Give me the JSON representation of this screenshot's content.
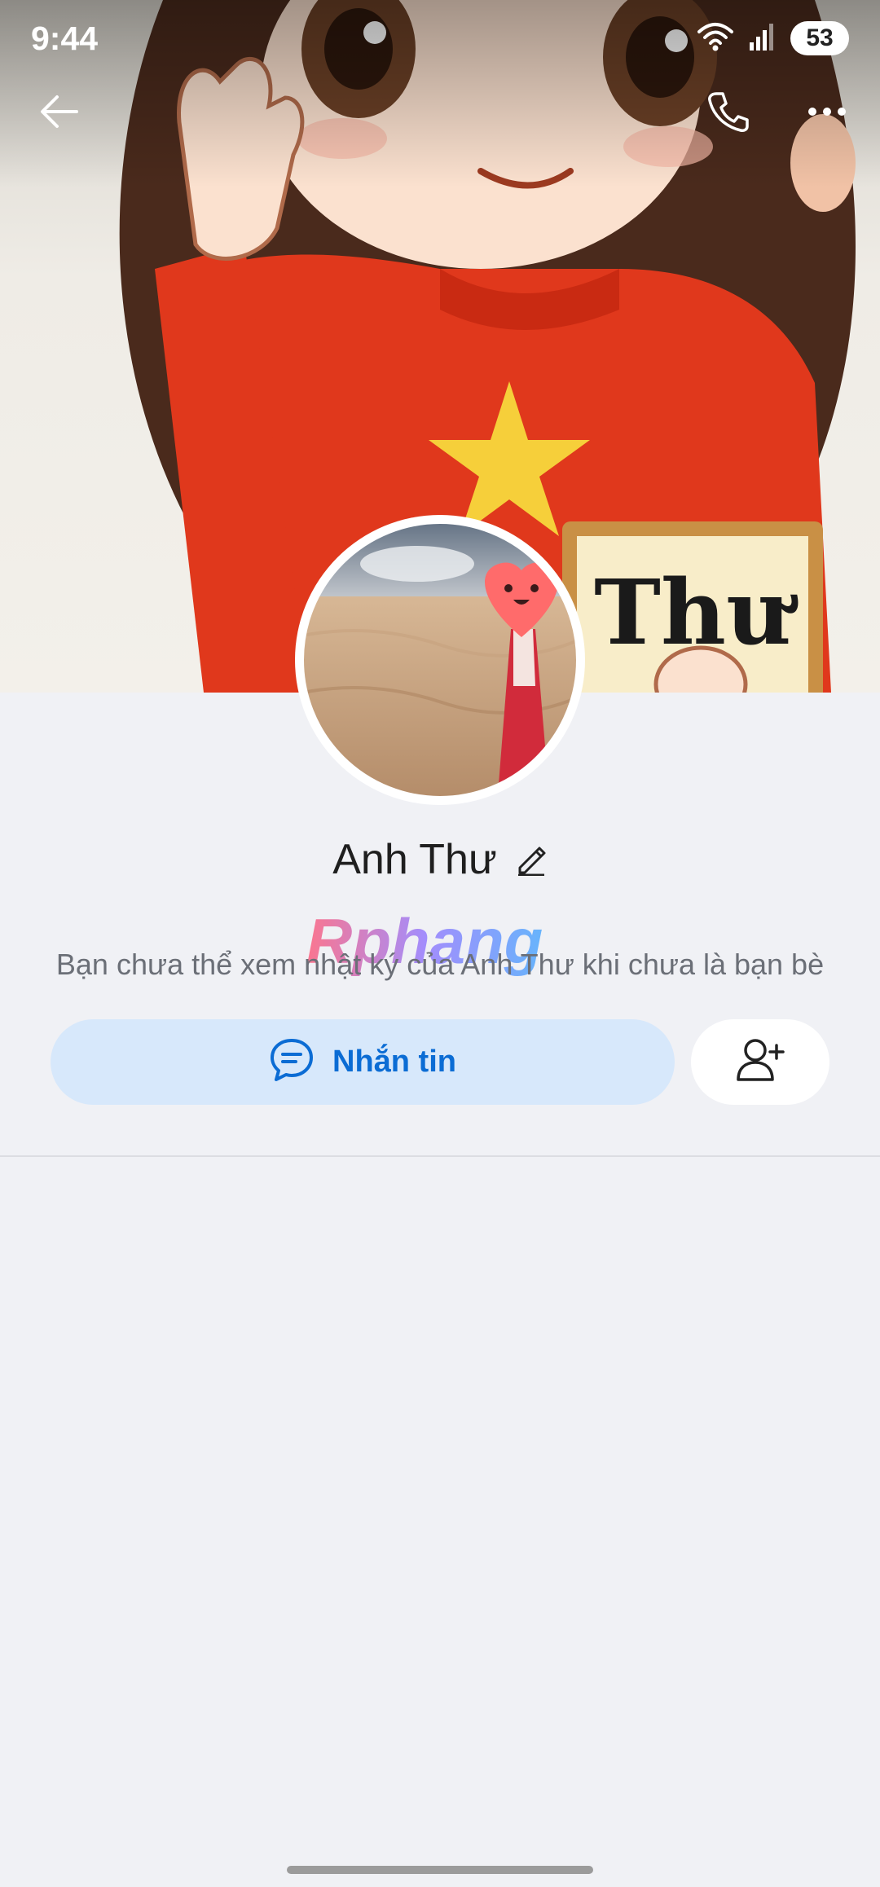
{
  "status_bar": {
    "time": "9:44",
    "battery": "53"
  },
  "cover": {
    "sign_text": "Thư"
  },
  "profile": {
    "name": "Anh Thư"
  },
  "watermark": "Rphang",
  "notice": "Bạn chưa thể xem nhật ký của Anh Thư khi chưa là bạn bè",
  "actions": {
    "message_label": "Nhắn tin"
  },
  "icons": {
    "back": "back-arrow-icon",
    "call": "phone-icon",
    "more": "more-dots-icon",
    "edit": "pencil-icon",
    "message": "chat-bubble-icon",
    "add_friend": "add-friend-icon"
  },
  "colors": {
    "accent": "#0b6cd4",
    "message_button_bg": "#d7e8fb",
    "page_bg": "#f0f1f5"
  }
}
